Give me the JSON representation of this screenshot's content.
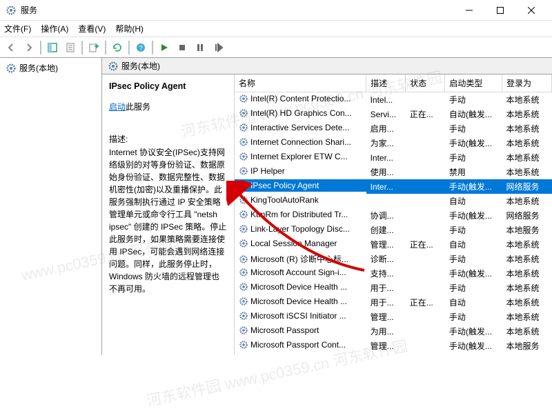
{
  "window": {
    "title": "服务"
  },
  "menu": {
    "file": "文件(F)",
    "action": "操作(A)",
    "view": "查看(V)",
    "help": "帮助(H)"
  },
  "nav": {
    "label": "服务(本地)"
  },
  "tab": {
    "label": "服务(本地)"
  },
  "detail": {
    "name": "IPsec Policy Agent",
    "start_link": "启动",
    "start_suffix": "此服务",
    "desc_label": "描述:",
    "desc": "Internet 协议安全(IPSec)支持网络级别的对等身份验证、数据原始身份验证、数据完整性、数据机密性(加密)以及重播保护。此服务强制执行通过 IP 安全策略管理单元或命令行工具 \"netsh ipsec\" 创建的 IPSec 策略。停止此服务时，如果策略需要连接使用 IPSec，可能会遇到网络连接问题。同样，此服务停止时，Windows 防火墙的远程管理也不再可用。"
  },
  "columns": {
    "name": "名称",
    "desc": "描述",
    "status": "状态",
    "startup": "启动类型",
    "logon": "登录为"
  },
  "col_widths": {
    "name": 180,
    "desc": 54,
    "status": 54,
    "startup": 78,
    "logon": 68
  },
  "rows": [
    {
      "name": "Intel(R) Content Protectio...",
      "desc": "Intel...",
      "status": "",
      "startup": "手动",
      "logon": "本地系统"
    },
    {
      "name": "Intel(R) HD Graphics Con...",
      "desc": "Servi...",
      "status": "正在...",
      "startup": "自动(触发...",
      "logon": "本地系统"
    },
    {
      "name": "Interactive Services Dete...",
      "desc": "启用...",
      "status": "",
      "startup": "手动",
      "logon": "本地系统"
    },
    {
      "name": "Internet Connection Shari...",
      "desc": "为家...",
      "status": "",
      "startup": "手动(触发...",
      "logon": "本地系统"
    },
    {
      "name": "Internet Explorer ETW C...",
      "desc": "Inter...",
      "status": "",
      "startup": "手动",
      "logon": "本地系统"
    },
    {
      "name": "IP Helper",
      "desc": "使用...",
      "status": "",
      "startup": "禁用",
      "logon": "本地系统"
    },
    {
      "name": "IPsec Policy Agent",
      "desc": "Inter...",
      "status": "",
      "startup": "手动(触发...",
      "logon": "网络服务",
      "selected": true
    },
    {
      "name": "KingToolAutoRank",
      "desc": "",
      "status": "",
      "startup": "自动",
      "logon": "本地系统"
    },
    {
      "name": "KtmRm for Distributed Tr...",
      "desc": "协调...",
      "status": "",
      "startup": "手动(触发...",
      "logon": "网络服务"
    },
    {
      "name": "Link-Layer Topology Disc...",
      "desc": "创建...",
      "status": "",
      "startup": "手动",
      "logon": "本地服务"
    },
    {
      "name": "Local Session Manager",
      "desc": "管理...",
      "status": "正在...",
      "startup": "自动",
      "logon": "本地系统"
    },
    {
      "name": "Microsoft (R) 诊断中心标...",
      "desc": "诊断...",
      "status": "",
      "startup": "手动",
      "logon": "本地系统"
    },
    {
      "name": "Microsoft Account Sign-i...",
      "desc": "支持...",
      "status": "",
      "startup": "手动(触发...",
      "logon": "本地系统"
    },
    {
      "name": "Microsoft Device Health ...",
      "desc": "用于...",
      "status": "",
      "startup": "手动",
      "logon": "本地系统"
    },
    {
      "name": "Microsoft Device Health ...",
      "desc": "用于...",
      "status": "正在...",
      "startup": "自动",
      "logon": "本地系统"
    },
    {
      "name": "Microsoft iSCSI Initiator ...",
      "desc": "管理...",
      "status": "",
      "startup": "手动",
      "logon": "本地系统"
    },
    {
      "name": "Microsoft Passport",
      "desc": "为用...",
      "status": "",
      "startup": "手动(触发...",
      "logon": "本地系统"
    },
    {
      "name": "Microsoft Passport Cont...",
      "desc": "管理...",
      "status": "",
      "startup": "手动(触发...",
      "logon": "本地服务"
    }
  ],
  "watermarks": [
    "河东软件园 www.pc0359.cn 河东软件园",
    "www.pc0359.cn 河东软件园",
    "河东软件园 www.pc0359.cn 河东软件园"
  ]
}
